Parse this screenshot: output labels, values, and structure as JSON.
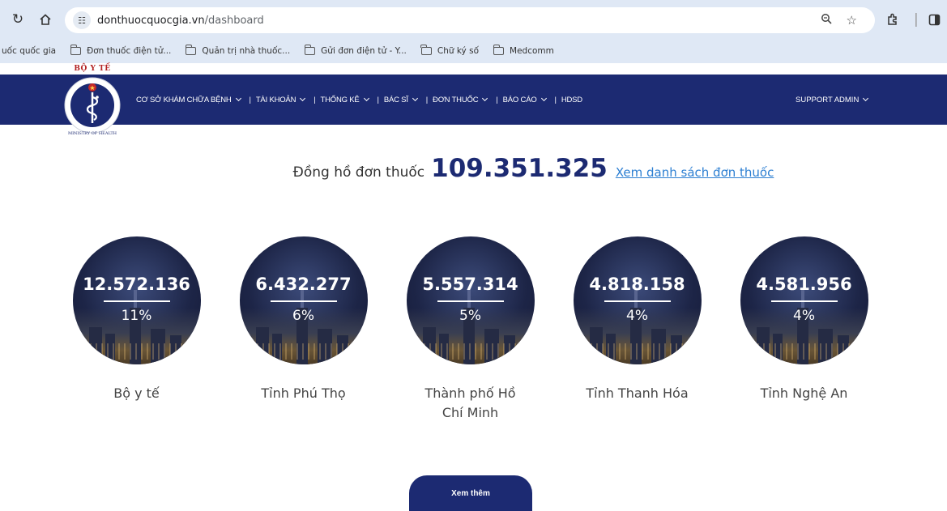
{
  "browser": {
    "url_domain": "donthuocquocgia.vn",
    "url_path": "/dashboard",
    "bookmarks": [
      "uốc quốc gia",
      "Đơn thuốc điện tử...",
      "Quản trị nhà thuốc...",
      "Gửi đơn điện tử - Y...",
      "Chữ ký số",
      "Medcomm"
    ]
  },
  "logo": {
    "text": "BỘ Y TẾ",
    "caption": "MINISTRY OF HEALTH"
  },
  "nav": {
    "items": [
      {
        "label": "CƠ SỞ KHÁM CHỮA BỆNH",
        "dropdown": true
      },
      {
        "label": "TÀI KHOẢN",
        "dropdown": true
      },
      {
        "label": "THỐNG KÊ",
        "dropdown": true
      },
      {
        "label": "BÁC SĨ",
        "dropdown": true
      },
      {
        "label": "ĐƠN THUỐC",
        "dropdown": true
      },
      {
        "label": "BÁO CÁO",
        "dropdown": true
      },
      {
        "label": "HDSD",
        "dropdown": false
      }
    ],
    "admin_label": "SUPPORT ADMIN"
  },
  "counter": {
    "label": "Đồng hồ đơn thuốc",
    "value": "109.351.325",
    "link": "Xem danh sách đơn thuốc"
  },
  "cards": [
    {
      "count": "12.572.136",
      "percent": "11%",
      "name": "Bộ y tế"
    },
    {
      "count": "6.432.277",
      "percent": "6%",
      "name": "Tỉnh Phú Thọ"
    },
    {
      "count": "5.557.314",
      "percent": "5%",
      "name": "Thành phố Hồ Chí Minh"
    },
    {
      "count": "4.818.158",
      "percent": "4%",
      "name": "Tỉnh Thanh Hóa"
    },
    {
      "count": "4.581.956",
      "percent": "4%",
      "name": "Tỉnh Nghệ An"
    }
  ],
  "more_button": "Xem thêm",
  "colors": {
    "brand": "#1c2a72",
    "link": "#2d7fd2",
    "chrome": "#dfe8f5",
    "logo_red": "#b21f1f"
  }
}
